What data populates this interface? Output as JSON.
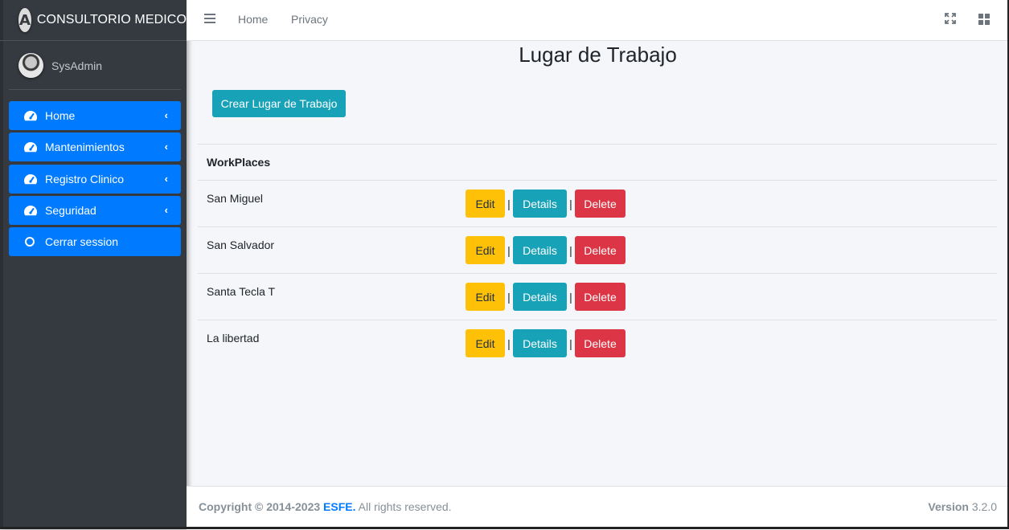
{
  "brand": {
    "logo_letter": "A",
    "name": "CONSULTORIO MEDICO"
  },
  "user": {
    "name": "SysAdmin"
  },
  "sidebar": {
    "items": [
      {
        "label": "Home",
        "icon": "tachometer-icon",
        "has_chevron": true
      },
      {
        "label": "Mantenimientos",
        "icon": "tachometer-icon",
        "has_chevron": true
      },
      {
        "label": "Registro Clinico",
        "icon": "tachometer-icon",
        "has_chevron": true
      },
      {
        "label": "Seguridad",
        "icon": "tachometer-icon",
        "has_chevron": true
      },
      {
        "label": "Cerrar session",
        "icon": "circle-icon",
        "has_chevron": false
      }
    ],
    "chevron": "‹"
  },
  "topbar": {
    "links": [
      "Home",
      "Privacy"
    ],
    "icons": [
      "menu-icon",
      "fullscreen-icon",
      "grid-icon"
    ]
  },
  "main": {
    "title": "Lugar de Trabajo",
    "create_button": "Crear Lugar de Trabajo",
    "table": {
      "header": "WorkPlaces",
      "rows": [
        {
          "name": "San Miguel"
        },
        {
          "name": "San Salvador"
        },
        {
          "name": "Santa Tecla T"
        },
        {
          "name": "La libertad"
        }
      ],
      "actions": {
        "edit": "Edit",
        "details": "Details",
        "delete": "Delete",
        "separator": "|"
      }
    }
  },
  "footer": {
    "copyright_prefix": "Copyright © 2014-2023",
    "brand": "ESFE.",
    "suffix": "All rights reserved.",
    "version_label": "Version",
    "version_number": "3.2.0"
  },
  "colors": {
    "sidebar_bg": "#343a40",
    "primary": "#007bff",
    "info": "#17a2b8",
    "warning": "#ffc107",
    "danger": "#dc3545",
    "content_bg": "#f4f6f9"
  }
}
